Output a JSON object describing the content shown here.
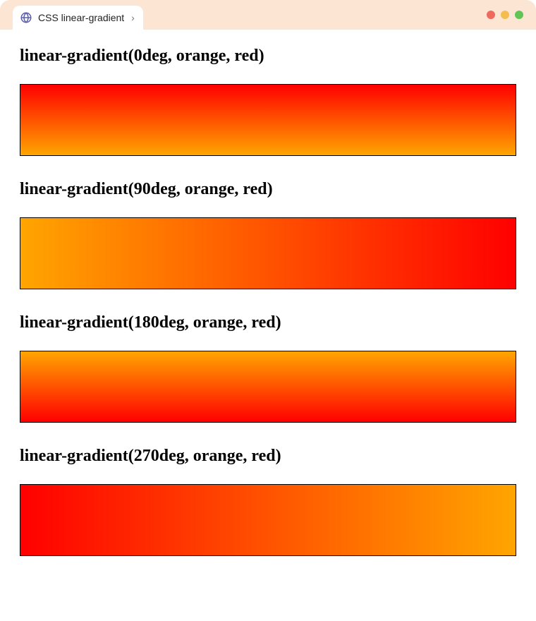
{
  "tab": {
    "title": "CSS linear-gradient"
  },
  "examples": [
    {
      "title": "linear-gradient(0deg, orange, red)",
      "css": "linear-gradient(0deg, orange, red)",
      "angle_deg": 0,
      "from": "orange",
      "to": "red"
    },
    {
      "title": "linear-gradient(90deg, orange, red)",
      "css": "linear-gradient(90deg, orange, red)",
      "angle_deg": 90,
      "from": "orange",
      "to": "red"
    },
    {
      "title": "linear-gradient(180deg, orange, red)",
      "css": "linear-gradient(180deg, orange, red)",
      "angle_deg": 180,
      "from": "orange",
      "to": "red"
    },
    {
      "title": "linear-gradient(270deg, orange, red)",
      "css": "linear-gradient(270deg, orange, red)",
      "angle_deg": 270,
      "from": "orange",
      "to": "red"
    }
  ]
}
